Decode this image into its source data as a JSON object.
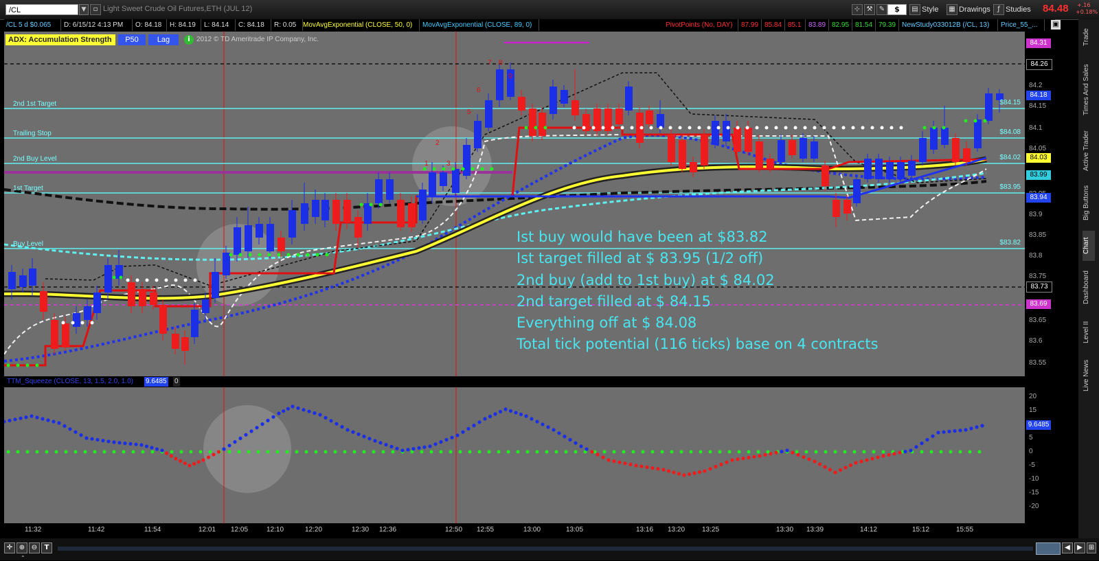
{
  "toolbar": {
    "symbol": "/CL",
    "description": "Light Sweet Crude Oil Futures,ETH (JUL 12)",
    "dollar_label": "$",
    "style_label": "Style",
    "drawings_label": "Drawings",
    "studies_label": "Studies",
    "last_price": "84.48",
    "change_abs": "+.16",
    "change_pct": "+0.18%"
  },
  "infobar": {
    "symbol_tf": "/CL 5 d $0.065",
    "date": "D: 6/15/12 4:13 PM",
    "open": "O: 84.18",
    "high": "H: 84.19",
    "low": "L: 84.14",
    "close": "C: 84.18",
    "range": "R: 0.05",
    "ma1": "MovAvgExponential (CLOSE, 50, 0)",
    "ma2": "MovAvgExponential (CLOSE, 89, 0)",
    "pivot_label": "PivotPoints (No, DAY)",
    "pivot_values": [
      "87.99",
      "85.84",
      "85.1",
      "83.89",
      "82.95",
      "81.54",
      "79.39"
    ],
    "newstudy": "NewStudy033012B (/CL, 13)",
    "price_study": "Price_55_..."
  },
  "study_header": {
    "adx_label": "ADX:",
    "adx_value": "Accumulation Strength",
    "p50": "P50",
    "lag": "Lag",
    "info": "i",
    "copyright": "2012 © TD Ameritrade IP Company, Inc."
  },
  "levels": [
    {
      "name": "2nd 1st Target",
      "price": "$84.15"
    },
    {
      "name": "Trailing Stop",
      "price": "$84.08"
    },
    {
      "name": "2nd Buy Level",
      "price": "$84.02"
    },
    {
      "name": "1st Target",
      "price": "$83.95"
    },
    {
      "name": "Buy Level",
      "price": "$83.82"
    }
  ],
  "annotation": [
    "Ist buy would have been at $83.82",
    "Ist target filled at $ 83.95 (1/2 off)",
    "2nd buy (add to 1st buy) at $ 84.02",
    "2nd target filled at $ 84.15",
    "Everything off at $ 84.08",
    "Total tick potential (116 ticks) base on 4 contracts"
  ],
  "price_axis": {
    "ticks": [
      "84.2",
      "84.15",
      "84.1",
      "84.05",
      "83.95",
      "83.9",
      "83.85",
      "83.8",
      "83.75",
      "83.65",
      "83.6",
      "83.55"
    ],
    "boxes": [
      {
        "label": "84.31",
        "bg": "#cc33cc",
        "fg": "#ffffff"
      },
      {
        "label": "84.26",
        "bg": "#000000",
        "fg": "#ffffff"
      },
      {
        "label": "84.18",
        "bg": "#2244ee",
        "fg": "#ffffff"
      },
      {
        "label": "84.03",
        "bg": "#ffff33",
        "fg": "#000000"
      },
      {
        "label": "83.99",
        "bg": "#33ccdd",
        "fg": "#000000"
      },
      {
        "label": "83.94",
        "bg": "#2244ee",
        "fg": "#ffffff"
      },
      {
        "label": "83.73",
        "bg": "#000000",
        "fg": "#ffffff"
      },
      {
        "label": "83.69",
        "bg": "#cc33cc",
        "fg": "#ffffff"
      }
    ]
  },
  "lower_study": {
    "title": "TTM_Squeeze (CLOSE, 13, 1.5, 2.0, 1.0)",
    "value1": "9.6485",
    "value2": "0",
    "ticks": [
      "20",
      "15",
      "10",
      "5",
      "0",
      "-5",
      "-10",
      "-15",
      "-20"
    ],
    "current_box": "9.6485"
  },
  "time_axis": [
    "11:32",
    "11:42",
    "11:54",
    "12:01",
    "12:05",
    "12:10",
    "12:20",
    "12:30",
    "12:36",
    "12:50",
    "12:55",
    "13:00",
    "13:05",
    "13:16",
    "13:20",
    "13:25",
    "13:30",
    "13:39",
    "14:12",
    "15:12",
    "15:55"
  ],
  "side_tabs": [
    "Trade",
    "Times And Sales",
    "Active Trader",
    "Big Buttons",
    "Chart",
    "Dashboard",
    "Level II",
    "Live News"
  ],
  "colors": {
    "up_candle": "#1b2fe6",
    "down_candle": "#ee1c1c",
    "level_line": "#5ff0f0",
    "annotation": "#48e6f0",
    "ma_fast": "#ffff33",
    "chart_bg": "#6e6e6e"
  }
}
